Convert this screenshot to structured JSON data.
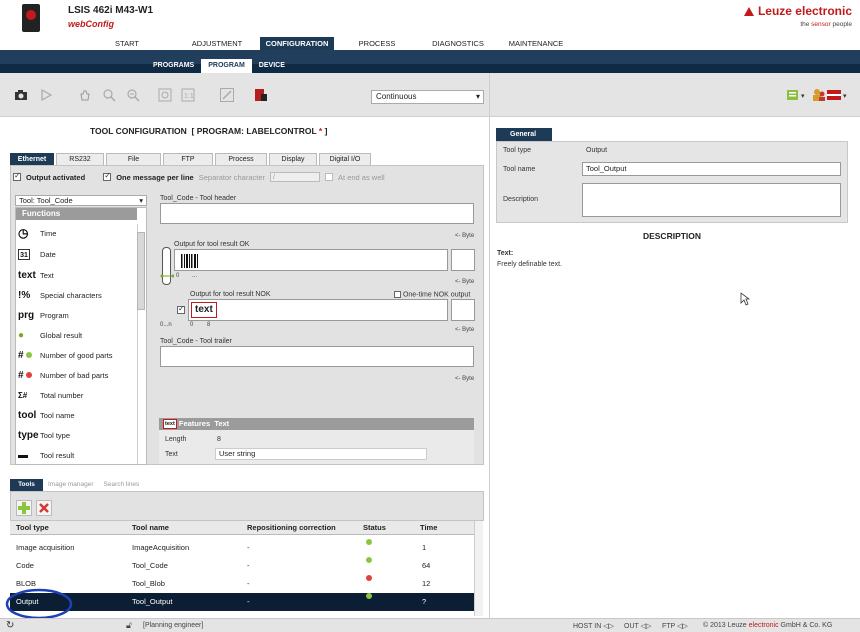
{
  "header": {
    "product": "LSIS 462i M43-W1",
    "app": "webConfig",
    "brand": "Leuze electronic",
    "tagline_pre": "the ",
    "tagline_em": "sensor",
    "tagline_post": " people"
  },
  "topnav": [
    "START",
    "ADJUSTMENT",
    "CONFIGURATION",
    "PROCESS",
    "DIAGNOSTICS",
    "MAINTENANCE"
  ],
  "subnav": [
    "PROGRAMS",
    "PROGRAM",
    "DEVICE"
  ],
  "toolbar": {
    "mode_select": "Continuous"
  },
  "tool_config": {
    "title": "TOOL CONFIGURATION",
    "program_label": "[ PROGRAM: LABELCONTROL ",
    "program_star": "*",
    "program_close": " ]"
  },
  "tabs": [
    "Ethernet",
    "RS232",
    "File",
    "FTP",
    "Process",
    "Display",
    "Digital I/O"
  ],
  "options": {
    "output_activated": "Output activated",
    "one_message": "One message per line",
    "separator_label": "Separator character",
    "separator_value": "/",
    "at_end": "At end as well"
  },
  "tool_select": "Tool: Tool_Code",
  "functions": {
    "header": "Functions",
    "items": [
      {
        "icon": "clock-icon",
        "glyph": "◷",
        "label": "Time"
      },
      {
        "icon": "calendar-icon",
        "glyph": "31",
        "label": "Date"
      },
      {
        "icon": "text-icon",
        "glyph": "text",
        "label": "Text"
      },
      {
        "icon": "percent-icon",
        "glyph": "!%",
        "label": "Special characters"
      },
      {
        "icon": "program-icon",
        "glyph": "prg",
        "label": "Program"
      },
      {
        "icon": "global-result-icon",
        "glyph": "●",
        "label": "Global result"
      },
      {
        "icon": "good-parts-icon",
        "glyph": "#",
        "label": "Number of good parts"
      },
      {
        "icon": "bad-parts-icon",
        "glyph": "#",
        "label": "Number of bad parts"
      },
      {
        "icon": "total-number-icon",
        "glyph": "Σ#",
        "label": "Total number"
      },
      {
        "icon": "tool-name-icon",
        "glyph": "tool",
        "label": "Tool name"
      },
      {
        "icon": "tool-type-icon",
        "glyph": "type",
        "label": "Tool type"
      },
      {
        "icon": "tool-result-icon",
        "glyph": "▬",
        "label": "Tool result"
      }
    ]
  },
  "editor": {
    "header_label": "Tool_Code - Tool header",
    "ok_label": "Output for tool result OK",
    "nok_label": "Output for tool result NOK",
    "onetime_label": "One-time NOK output",
    "nok_text": "text",
    "trailer_label": "Tool_Code - Tool trailer",
    "byte": "<- Byte",
    "zero": "0",
    "dots": "...",
    "range": "0...n",
    "tick0": "0",
    "tick8": "8"
  },
  "features": {
    "tag": "text",
    "title": "Features",
    "type": "Text",
    "length_label": "Length",
    "length_value": "8",
    "text_label": "Text",
    "text_value": "User string"
  },
  "tools_panel": {
    "tabs": [
      "Tools",
      "Image manager",
      "Search lines"
    ],
    "columns": [
      "Tool type",
      "Tool name",
      "Repositioning correction",
      "Status",
      "Time"
    ],
    "rows": [
      {
        "type": "Image acquisition",
        "name": "ImageAcquisition",
        "repos": "-",
        "status": "#8cc63f",
        "time": "1"
      },
      {
        "type": "Code",
        "name": "Tool_Code",
        "repos": "-",
        "status": "#8cc63f",
        "time": "64"
      },
      {
        "type": "BLOB",
        "name": "Tool_Blob",
        "repos": "-",
        "status": "#e2413a",
        "time": "12"
      },
      {
        "type": "Output",
        "name": "Tool_Output",
        "repos": "-",
        "status": "#8cc63f",
        "time": "?"
      }
    ]
  },
  "right_panel": {
    "tab": "General",
    "tool_type_label": "Tool type",
    "tool_type_value": "Output",
    "tool_name_label": "Tool name",
    "tool_name_value": "Tool_Output",
    "description_label": "Description",
    "desc_title": "DESCRIPTION",
    "desc_head": "Text:",
    "desc_body": "Freely definable text."
  },
  "status_bar": {
    "user": "[Planning engineer]",
    "host": "HOST IN",
    "out": "OUT",
    "ftp": "FTP",
    "copyright_pre": "© 2013 Leuze ",
    "copyright_em": "electronic",
    "copyright_post": " GmbH & Co. KG"
  },
  "colors": {
    "nav_dark": "#1d3a56",
    "brand_red": "#c21a1a",
    "selected_row": "#0b1e33",
    "highlight_ellipse": "#1e3fb5"
  }
}
